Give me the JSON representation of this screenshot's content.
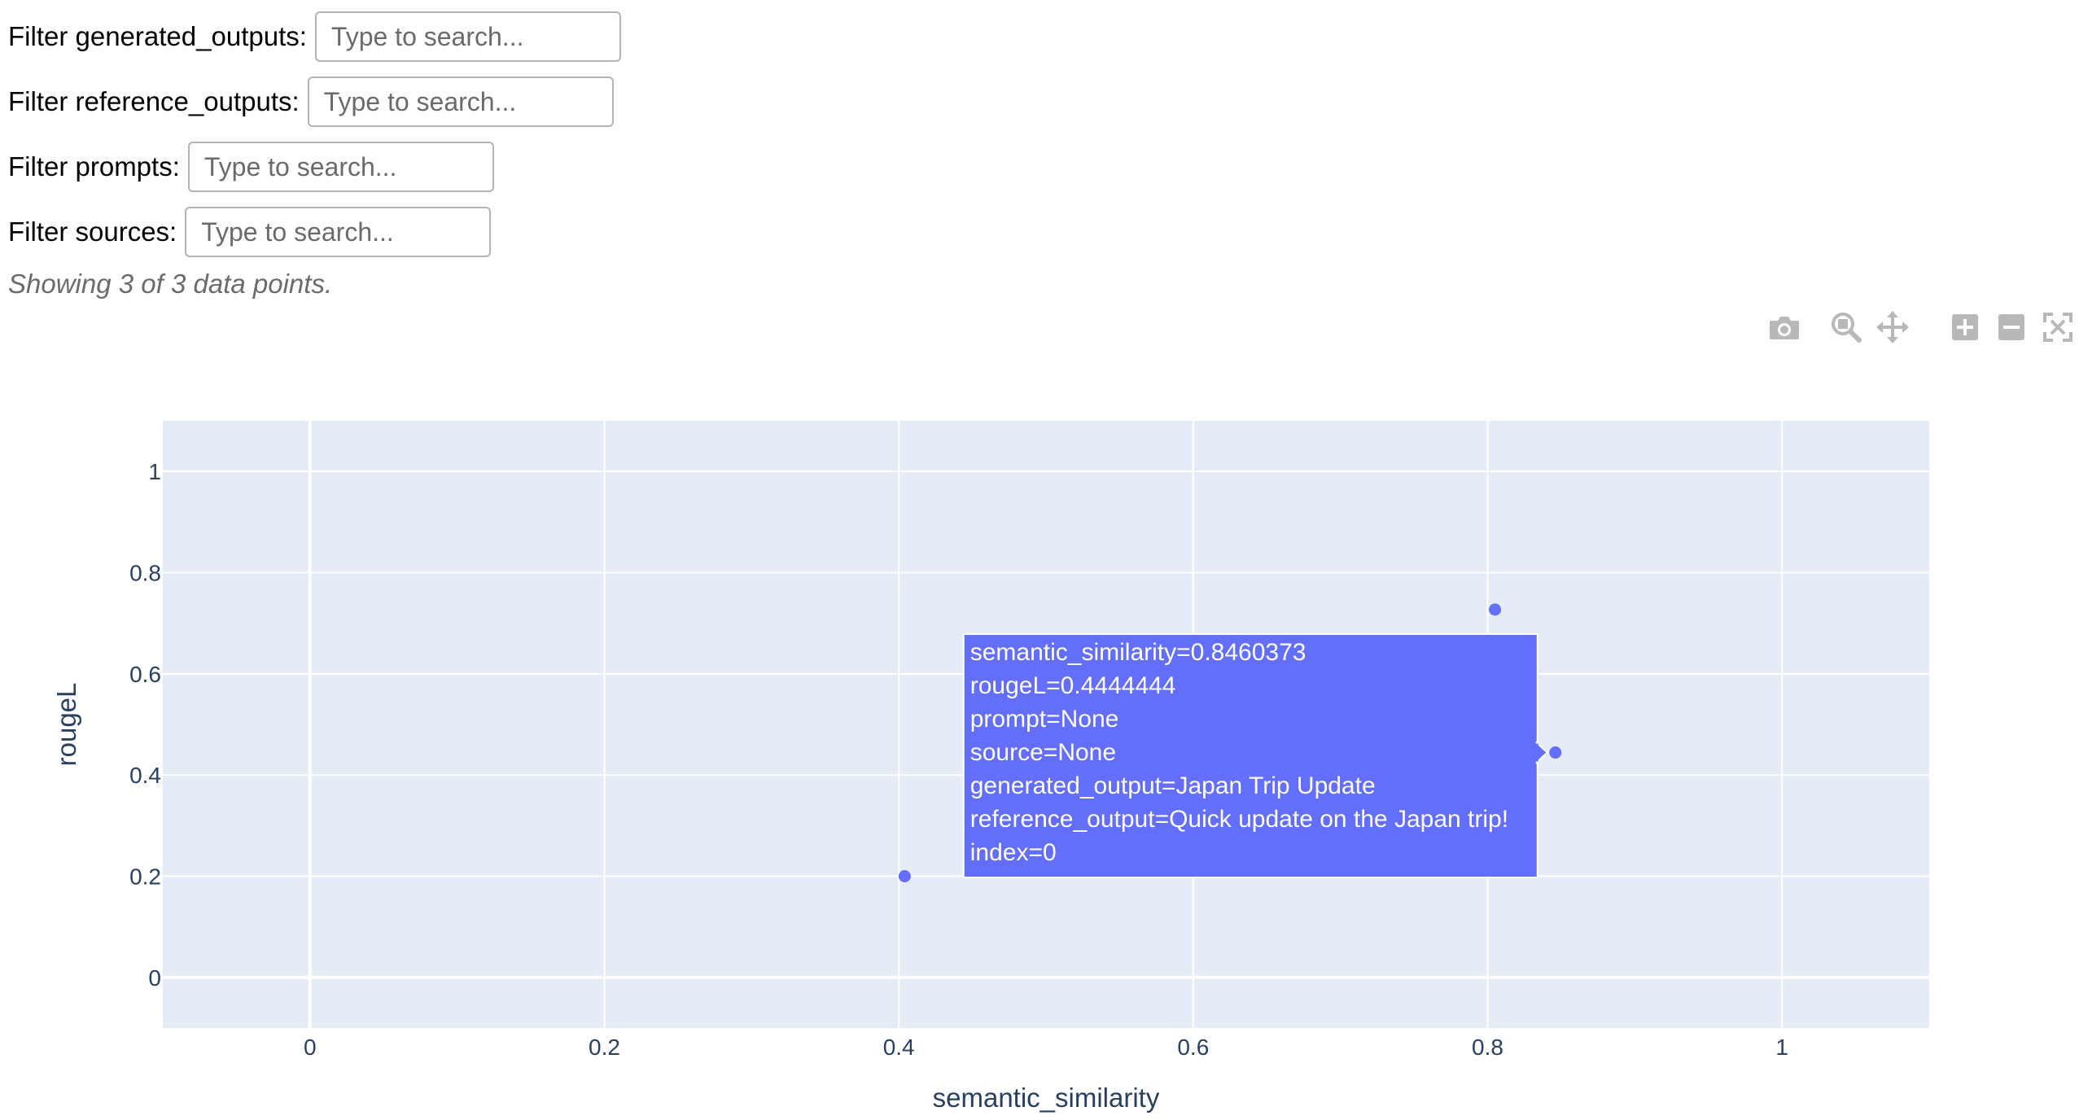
{
  "filters": [
    {
      "label": "Filter generated_outputs:",
      "placeholder": "Type to search...",
      "value": ""
    },
    {
      "label": "Filter reference_outputs:",
      "placeholder": "Type to search...",
      "value": ""
    },
    {
      "label": "Filter prompts:",
      "placeholder": "Type to search...",
      "value": ""
    },
    {
      "label": "Filter sources:",
      "placeholder": "Type to search...",
      "value": ""
    }
  ],
  "status": {
    "showing_text": "Showing 3 of 3 data points."
  },
  "modebar": {
    "buttons": [
      {
        "name": "camera-icon",
        "tooltip": "Download plot as a png"
      },
      {
        "name": "zoom-icon",
        "tooltip": "Zoom"
      },
      {
        "name": "pan-icon",
        "tooltip": "Pan"
      },
      {
        "name": "zoom-in-icon",
        "tooltip": "Zoom in"
      },
      {
        "name": "zoom-out-icon",
        "tooltip": "Zoom out"
      },
      {
        "name": "autoscale-icon",
        "tooltip": "Autoscale"
      }
    ],
    "icon_color": "#b8b8b8"
  },
  "chart_data": {
    "type": "scatter",
    "xlabel": "semantic_similarity",
    "ylabel": "rougeL",
    "xlim": [
      -0.2,
      2.2
    ],
    "ylim": [
      -0.1,
      1.1
    ],
    "xticks": [
      0,
      0.2,
      0.4,
      0.6,
      0.8,
      1
    ],
    "xtick_labels": [
      "0",
      "0.2",
      "0.4",
      "0.6",
      "0.8",
      "1"
    ],
    "yticks": [
      0,
      0.2,
      0.4,
      0.6,
      0.8,
      1
    ],
    "ytick_labels": [
      "0",
      "0.2",
      "0.4",
      "0.6",
      "0.8",
      "1"
    ],
    "grid": true,
    "plot_bg": "#e5ecf6",
    "marker_color": "#636efa",
    "points": [
      {
        "x": 0.8460373,
        "y": 0.4444444
      },
      {
        "x": 0.805,
        "y": 0.727
      },
      {
        "x": 0.404,
        "y": 0.2
      }
    ],
    "hover": {
      "point_index": 0,
      "bg_color": "#636efa",
      "lines": [
        "semantic_similarity=0.8460373",
        "rougeL=0.4444444",
        "prompt=None",
        "source=None",
        "generated_output=Japan Trip Update",
        "reference_output=Quick update on the Japan trip!",
        "index=0"
      ]
    }
  }
}
